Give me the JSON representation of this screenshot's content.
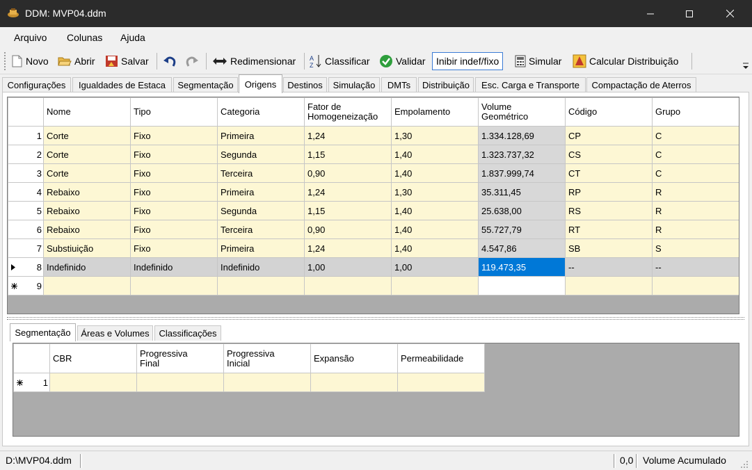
{
  "window": {
    "title": "DDM: MVP04.ddm"
  },
  "menu": [
    "Arquivo",
    "Colunas",
    "Ajuda"
  ],
  "toolbar": {
    "novo": "Novo",
    "abrir": "Abrir",
    "salvar": "Salvar",
    "redimensionar": "Redimensionar",
    "classificar": "Classificar",
    "validar": "Validar",
    "inibir": "Inibir indef/fixo",
    "simular": "Simular",
    "calcular": "Calcular Distribuição"
  },
  "tabs": [
    "Configurações",
    "Igualdades de Estaca",
    "Segmentação",
    "Origens",
    "Destinos",
    "Simulação",
    "DMTs",
    "Distribuição",
    "Esc. Carga e Transporte",
    "Compactação de Aterros"
  ],
  "main_grid": {
    "headers": {
      "nome": "Nome",
      "tipo": "Tipo",
      "categoria": "Categoria",
      "fator_1": "Fator de",
      "fator_2": "Homogeneização",
      "empolamento": "Empolamento",
      "volume_1": "Volume",
      "volume_2": "Geométrico",
      "codigo": "Código",
      "grupo": "Grupo"
    },
    "rows": [
      [
        "1",
        "Corte",
        "Fixo",
        "Primeira",
        "1,24",
        "1,30",
        "1.334.128,69",
        "CP",
        "C"
      ],
      [
        "2",
        "Corte",
        "Fixo",
        "Segunda",
        "1,15",
        "1,40",
        "1.323.737,32",
        "CS",
        "C"
      ],
      [
        "3",
        "Corte",
        "Fixo",
        "Terceira",
        "0,90",
        "1,40",
        "1.837.999,74",
        "CT",
        "C"
      ],
      [
        "4",
        "Rebaixo",
        "Fixo",
        "Primeira",
        "1,24",
        "1,30",
        "35.311,45",
        "RP",
        "R"
      ],
      [
        "5",
        "Rebaixo",
        "Fixo",
        "Segunda",
        "1,15",
        "1,40",
        "25.638,00",
        "RS",
        "R"
      ],
      [
        "6",
        "Rebaixo",
        "Fixo",
        "Terceira",
        "0,90",
        "1,40",
        "55.727,79",
        "RT",
        "R"
      ],
      [
        "7",
        "Substiuição",
        "Fixo",
        "Primeira",
        "1,24",
        "1,40",
        "4.547,86",
        "SB",
        "S"
      ],
      [
        "8",
        "Indefinido",
        "Indefinido",
        "Indefinido",
        "1,00",
        "1,00",
        "119.473,35",
        "--",
        "--"
      ]
    ],
    "new_row": "9"
  },
  "sub_tabs": [
    "Segmentação",
    "Áreas e Volumes",
    "Classificações"
  ],
  "sub_grid": {
    "headers": {
      "cbr": "CBR",
      "pf_1": "Progressiva",
      "pf_2": "Final",
      "pi_1": "Progressiva",
      "pi_2": "Inicial",
      "expansao": "Expansão",
      "permeabilidade": "Permeabilidade"
    },
    "new_row": "1"
  },
  "status": {
    "file": "D:\\MVP04.ddm",
    "value": "0,0",
    "label": "Volume Acumulado"
  },
  "colors": {
    "titlebar": "#2b2b2b",
    "cell": "#fdf7d4",
    "selected": "#0078d7",
    "grid_bg": "#ababab"
  }
}
